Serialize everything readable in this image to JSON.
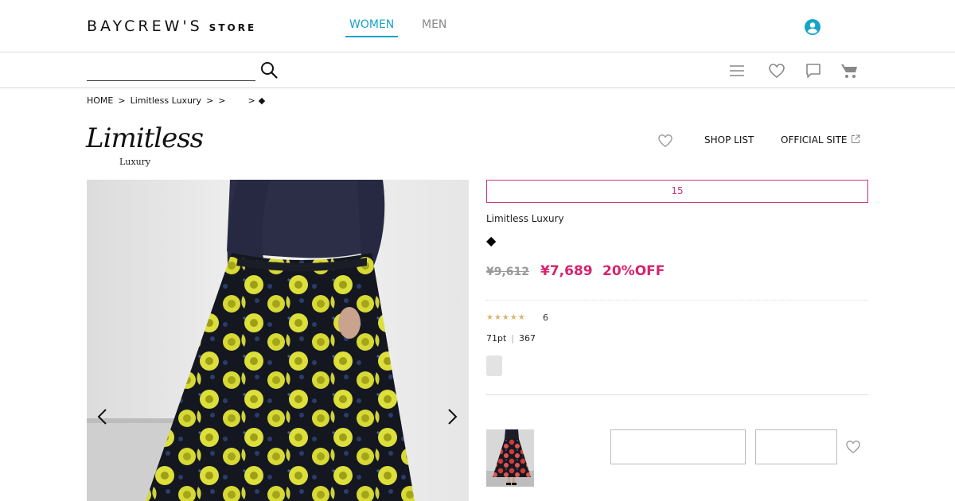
{
  "header": {
    "logo_main": "BAYCREW'S",
    "logo_store": "STORE",
    "tabs": [
      {
        "label": "WOMEN",
        "active": true
      },
      {
        "label": "MEN",
        "active": false
      }
    ],
    "accent_color": "#1aa3c8",
    "account_icon": "user-circle-icon"
  },
  "search": {
    "value": "",
    "placeholder": ""
  },
  "header_icons": [
    "menu-icon",
    "heart-icon",
    "chat-icon",
    "cart-icon"
  ],
  "breadcrumb": [
    "HOME",
    ">",
    "Limitless Luxury",
    ">",
    ">",
    ">",
    "◆"
  ],
  "brand": {
    "logo_script": "Limitless",
    "logo_sub": "Luxury",
    "shop_list": "SHOP LIST",
    "official_site": "OFFICIAL SITE"
  },
  "product": {
    "campaign": "15",
    "brand": "Limitless Luxury",
    "name": "◆",
    "old_price": "¥9,612",
    "new_price": "¥7,689",
    "discount": "20%OFF",
    "price_color": "#d6246e",
    "stars": "★★★★★",
    "review_count": "6",
    "points": "71pt",
    "favorites": "367"
  }
}
